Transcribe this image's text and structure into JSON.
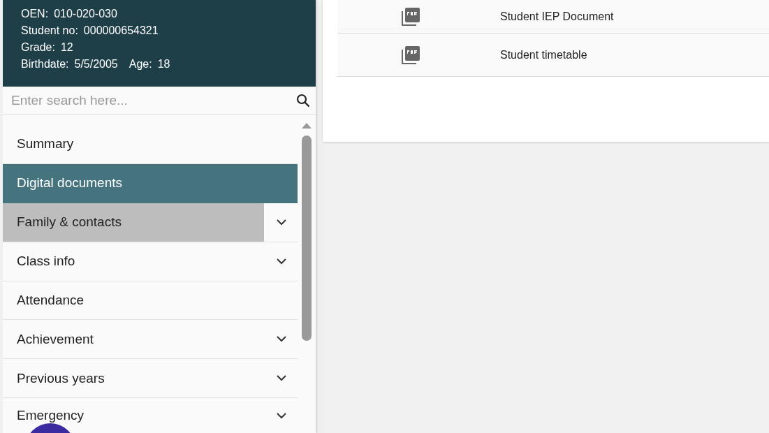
{
  "student": {
    "lines": [
      {
        "label": "OEN:",
        "value": "010-020-030"
      },
      {
        "label": "Student no:",
        "value": "000000654321"
      },
      {
        "label": "Grade:",
        "value": "12"
      },
      {
        "label": "Birthdate:",
        "value": "5/5/2005",
        "extra_label": "Age:",
        "extra_value": "18"
      }
    ]
  },
  "search": {
    "placeholder": "Enter search here..."
  },
  "nav": {
    "items": [
      {
        "label": "Summary",
        "selected": false,
        "hovered": false,
        "expandable": false
      },
      {
        "label": "Digital documents",
        "selected": true,
        "hovered": false,
        "expandable": false
      },
      {
        "label": "Family & contacts",
        "selected": false,
        "hovered": true,
        "expandable": true
      },
      {
        "label": "Class info",
        "selected": false,
        "hovered": false,
        "expandable": true
      },
      {
        "label": "Attendance",
        "selected": false,
        "hovered": false,
        "expandable": false
      },
      {
        "label": "Achievement",
        "selected": false,
        "hovered": false,
        "expandable": true
      },
      {
        "label": "Previous years",
        "selected": false,
        "hovered": false,
        "expandable": true
      },
      {
        "label": "Emergency",
        "selected": false,
        "hovered": false,
        "expandable": true
      }
    ]
  },
  "documents": {
    "rows": [
      {
        "name": "Student IEP Document"
      },
      {
        "name": "Student timetable"
      }
    ]
  }
}
